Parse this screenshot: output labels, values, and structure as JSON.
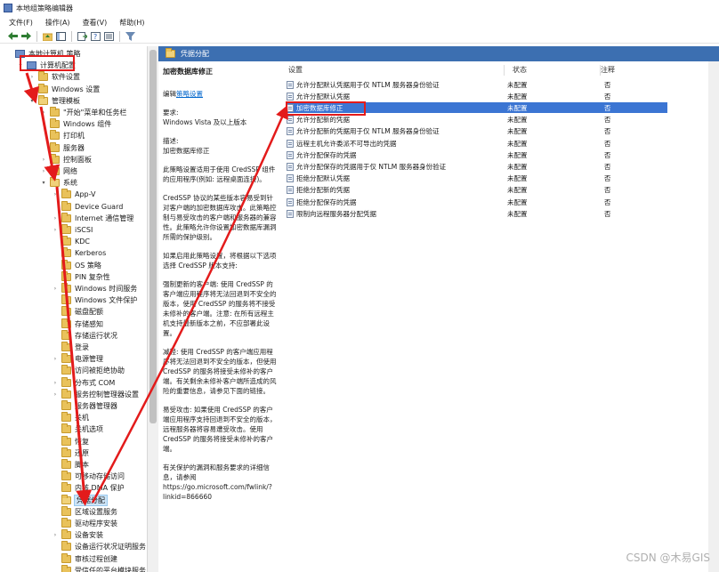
{
  "window": {
    "title": "本地组策略编辑器"
  },
  "menu": [
    "文件(F)",
    "操作(A)",
    "查看(V)",
    "帮助(H)"
  ],
  "toolbar_icons": [
    "back-arrow-icon",
    "forward-arrow-icon",
    "folder-up-icon",
    "show-hide-tree-icon",
    "export-icon",
    "help-icon",
    "properties-icon",
    "filter-icon"
  ],
  "tree": [
    {
      "label": "本地计算机 策略",
      "type": "pc",
      "level": 0,
      "exp": ""
    },
    {
      "label": "计算机配置",
      "type": "pc",
      "level": 1,
      "exp": "▾",
      "highlight": true
    },
    {
      "label": "软件设置",
      "type": "folder",
      "level": 2,
      "exp": "›"
    },
    {
      "label": "Windows 设置",
      "type": "folder",
      "level": 2,
      "exp": "›"
    },
    {
      "label": "管理模板",
      "type": "folder-open",
      "level": 2,
      "exp": "▾"
    },
    {
      "label": "\"开始\"菜单和任务栏",
      "type": "folder",
      "level": 3,
      "exp": "›"
    },
    {
      "label": "Windows 组件",
      "type": "folder",
      "level": 3,
      "exp": "›"
    },
    {
      "label": "打印机",
      "type": "folder",
      "level": 3,
      "exp": ""
    },
    {
      "label": "服务器",
      "type": "folder",
      "level": 3,
      "exp": ""
    },
    {
      "label": "控制面板",
      "type": "folder",
      "level": 3,
      "exp": "›"
    },
    {
      "label": "网络",
      "type": "folder",
      "level": 3,
      "exp": "›"
    },
    {
      "label": "系统",
      "type": "folder-open",
      "level": 3,
      "exp": "▾"
    },
    {
      "label": "App-V",
      "type": "folder",
      "level": 4,
      "exp": "›"
    },
    {
      "label": "Device Guard",
      "type": "folder",
      "level": 4,
      "exp": ""
    },
    {
      "label": "Internet 通信管理",
      "type": "folder",
      "level": 4,
      "exp": "›"
    },
    {
      "label": "iSCSI",
      "type": "folder",
      "level": 4,
      "exp": "›"
    },
    {
      "label": "KDC",
      "type": "folder",
      "level": 4,
      "exp": ""
    },
    {
      "label": "Kerberos",
      "type": "folder",
      "level": 4,
      "exp": ""
    },
    {
      "label": "OS 策略",
      "type": "folder",
      "level": 4,
      "exp": ""
    },
    {
      "label": "PIN 复杂性",
      "type": "folder",
      "level": 4,
      "exp": ""
    },
    {
      "label": "Windows 时间服务",
      "type": "folder",
      "level": 4,
      "exp": "›"
    },
    {
      "label": "Windows 文件保护",
      "type": "folder",
      "level": 4,
      "exp": ""
    },
    {
      "label": "磁盘配额",
      "type": "folder",
      "level": 4,
      "exp": ""
    },
    {
      "label": "存储感知",
      "type": "folder",
      "level": 4,
      "exp": ""
    },
    {
      "label": "存储运行状况",
      "type": "folder",
      "level": 4,
      "exp": ""
    },
    {
      "label": "登录",
      "type": "folder",
      "level": 4,
      "exp": ""
    },
    {
      "label": "电源管理",
      "type": "folder",
      "level": 4,
      "exp": "›"
    },
    {
      "label": "访问被拒绝协助",
      "type": "folder",
      "level": 4,
      "exp": ""
    },
    {
      "label": "分布式 COM",
      "type": "folder",
      "level": 4,
      "exp": "›"
    },
    {
      "label": "服务控制管理器设置",
      "type": "folder",
      "level": 4,
      "exp": "›"
    },
    {
      "label": "服务器管理器",
      "type": "folder",
      "level": 4,
      "exp": ""
    },
    {
      "label": "关机",
      "type": "folder",
      "level": 4,
      "exp": ""
    },
    {
      "label": "关机选项",
      "type": "folder",
      "level": 4,
      "exp": ""
    },
    {
      "label": "恢复",
      "type": "folder",
      "level": 4,
      "exp": ""
    },
    {
      "label": "还原",
      "type": "folder",
      "level": 4,
      "exp": ""
    },
    {
      "label": "脚本",
      "type": "folder",
      "level": 4,
      "exp": ""
    },
    {
      "label": "可移动存储访问",
      "type": "folder",
      "level": 4,
      "exp": ""
    },
    {
      "label": "内核 DMA 保护",
      "type": "folder",
      "level": 4,
      "exp": ""
    },
    {
      "label": "凭据分配",
      "type": "folder-open",
      "level": 4,
      "exp": "",
      "selected": true
    },
    {
      "label": "区域设置服务",
      "type": "folder",
      "level": 4,
      "exp": ""
    },
    {
      "label": "驱动程序安装",
      "type": "folder",
      "level": 4,
      "exp": ""
    },
    {
      "label": "设备安装",
      "type": "folder",
      "level": 4,
      "exp": "›"
    },
    {
      "label": "设备运行状况证明服务",
      "type": "folder",
      "level": 4,
      "exp": ""
    },
    {
      "label": "审核过程创建",
      "type": "folder",
      "level": 4,
      "exp": ""
    },
    {
      "label": "受信任的平台模块服务",
      "type": "folder",
      "level": 4,
      "exp": ""
    }
  ],
  "panel": {
    "header": "凭据分配",
    "desc_title": "加密数据库修正",
    "edit_prefix": "编辑",
    "edit_link": "策略设置",
    "desc_paragraphs": [
      "要求:\nWindows Vista 及以上版本",
      "描述:\n加密数据库修正",
      "此策略设置适用于使用 CredSSP 组件的应用程序(例如: 远程桌面连接)。",
      "CredSSP 协议的某些版本容易受到针对客户端的加密数据库攻击。此策略控制与易受攻击的客户端和服务器的兼容性。此策略允许你设置加密数据库漏洞所需的保护级别。",
      "如果启用此策略设置，将根据以下选项选择 CredSSP 版本支持:",
      "强制更新的客户端: 使用 CredSSP 的客户端应用程序将无法回退到不安全的版本，使用 CredSSP 的服务将不接受未修补的客户端。注意: 在所有远程主机支持最新版本之前，不应部署此设置。",
      "减轻: 使用 CredSSP 的客户端应用程序将无法回退到不安全的版本，但使用 CredSSP 的服务将接受未修补的客户端。有关剩余未修补客户端所造成的风险的重要信息，请参见下面的链接。",
      "易受攻击: 如果使用 CredSSP 的客户端应用程序支持回退到不安全的版本，远程服务器将容易遭受攻击。使用 CredSSP 的服务将接受未修补的客户端。",
      "有关保护的漏洞和服务要求的详细信息，请参阅\nhttps://go.microsoft.com/fwlink/?linkid=866660"
    ],
    "columns": {
      "setting": "设置",
      "state": "状态",
      "note": "注释"
    },
    "rows": [
      {
        "name": "允许分配默认凭据用于仅 NTLM 服务器身份验证",
        "state": "未配置",
        "note": "否"
      },
      {
        "name": "允许分配默认凭据",
        "state": "未配置",
        "note": "否"
      },
      {
        "name": "加密数据库修正",
        "state": "未配置",
        "note": "否",
        "selected": true
      },
      {
        "name": "允许分配新的凭据",
        "state": "未配置",
        "note": "否"
      },
      {
        "name": "允许分配新的凭据用于仅 NTLM 服务器身份验证",
        "state": "未配置",
        "note": "否"
      },
      {
        "name": "远程主机允许委派不可导出的凭据",
        "state": "未配置",
        "note": "否"
      },
      {
        "name": "允许分配保存的凭据",
        "state": "未配置",
        "note": "否"
      },
      {
        "name": "允许分配保存的凭据用于仅 NTLM 服务器身份验证",
        "state": "未配置",
        "note": "否"
      },
      {
        "name": "拒绝分配默认凭据",
        "state": "未配置",
        "note": "否"
      },
      {
        "name": "拒绝分配新的凭据",
        "state": "未配置",
        "note": "否"
      },
      {
        "name": "拒绝分配保存的凭据",
        "state": "未配置",
        "note": "否"
      },
      {
        "name": "限制向远程服务器分配凭据",
        "state": "未配置",
        "note": "否"
      }
    ]
  },
  "watermark": "CSDN @木易GIS",
  "annotation_color": "#e31b1b"
}
